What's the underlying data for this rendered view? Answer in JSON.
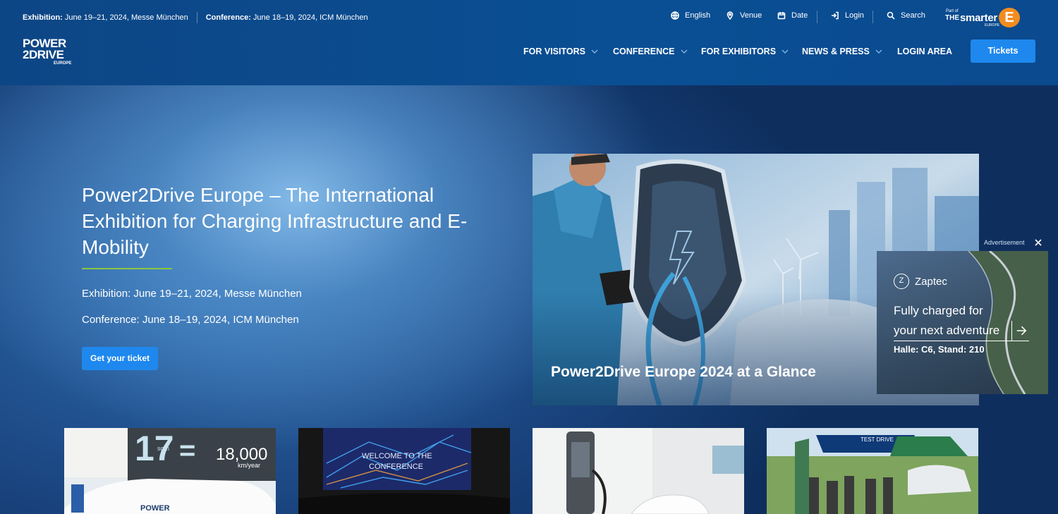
{
  "topbar": {
    "exhibition_label": "Exhibition:",
    "exhibition_text": "June 19–21, 2024, Messe München",
    "conference_label": "Conference:",
    "conference_text": "June 18–19, 2024, ICM München",
    "utilities": [
      {
        "label": "English",
        "icon": "globe-icon"
      },
      {
        "label": "Venue",
        "icon": "location-pin-icon"
      },
      {
        "label": "Date",
        "icon": "calendar-icon"
      },
      {
        "label": "Login",
        "icon": "login-icon"
      },
      {
        "label": "Search",
        "icon": "search-icon"
      }
    ],
    "brand": {
      "part_of": "Part of",
      "the": "THE",
      "smarter": "smarter",
      "europe": "EUROPE",
      "e": "E"
    }
  },
  "logo": {
    "line1": "POWER",
    "line2": "2DRIVE",
    "line3": "EUROPE"
  },
  "nav": {
    "items": [
      {
        "label": "FOR VISITORS",
        "has_dropdown": true
      },
      {
        "label": "CONFERENCE",
        "has_dropdown": true
      },
      {
        "label": "FOR EXHIBITORS",
        "has_dropdown": true
      },
      {
        "label": "NEWS & PRESS",
        "has_dropdown": true
      },
      {
        "label": "LOGIN AREA",
        "has_dropdown": false
      }
    ],
    "tickets_label": "Tickets"
  },
  "hero": {
    "title": "Power2Drive Europe – The International Exhibition for Charging Infrastructure and E-Mobility",
    "exhibition": "Exhibition: June 19–21, 2024, Messe München",
    "conference": "Conference: June 18–19, 2024, ICM München",
    "cta_label": "Get your ticket",
    "accent_color": "#8cc63f"
  },
  "glance": {
    "caption": "Power2Drive Europe 2024 at a Glance"
  },
  "ad": {
    "label": "Advertisement",
    "brand": "Zaptec",
    "line1": "Fully charged for",
    "line2": "your next adventure",
    "stand": "Halle: C6, Stand: 210"
  },
  "cards": [
    {
      "big_number": "17",
      "unit": "sqm",
      "equals": "=",
      "value": "18,000",
      "value_unit": "km/year",
      "tag": "POWER"
    },
    {
      "screen_text_1": "WELCOME TO THE",
      "screen_text_2": "CONFERENCE"
    },
    {},
    {
      "banner": "TEST DRIVE"
    }
  ],
  "colors": {
    "primary_blue": "#1e88ee",
    "header_bg": "#0d4685",
    "brand_orange": "#f28c1e"
  }
}
